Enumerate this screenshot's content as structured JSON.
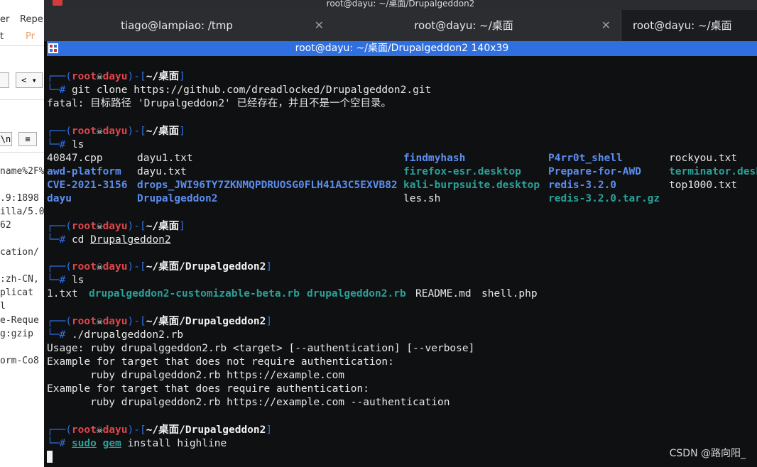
{
  "bg_app": {
    "menu": [
      "er",
      "Repe"
    ],
    "submenu": [
      "t",
      "Pr"
    ],
    "nav_back": "<",
    "nav_more": "▾",
    "toolbar_fmt": "\\n",
    "toolbar_menu": "≡",
    "lines": [
      "name%2F%",
      ".9:1898",
      "illa/5.0",
      " 62",
      "cation/",
      ":zh-CN,",
      "plicat",
      "l",
      "e-Reque",
      "g:gzip",
      "orm-Co8"
    ]
  },
  "window": {
    "title": "root@dayu: ~/桌面/Drupalgeddon2",
    "tabs": [
      {
        "label": "tiago@lampiao: /tmp"
      },
      {
        "label": "root@dayu: ~/桌面"
      },
      {
        "label": "root@dayu: ~/桌面"
      }
    ],
    "inner_title": "root@dayu: ~/桌面/Drupalgeddon2 140x39"
  },
  "prompt": {
    "user": "root",
    "skull": "☠",
    "host": "dayu",
    "home": "~/桌面",
    "dir": "~/桌面/Drupalgeddon2"
  },
  "session": {
    "cmd1": "git clone https://github.com/dreadlocked/Drupalgeddon2.git",
    "out1": "fatal: 目标路径 'Drupalgeddon2' 已经存在，并且不是一个空目录。",
    "cmd2": "ls",
    "ls_files": [
      [
        "40847.cpp",
        "dayu1.txt",
        "findmyhash",
        "P4rr0t_shell",
        "rockyou.txt"
      ],
      [
        "awd-platform",
        "dayu.txt",
        "firefox-esr.desktop",
        "Prepare-for-AWD",
        "terminator.desk"
      ],
      [
        "CVE-2021-3156",
        "drops_JWI96TY7ZKNMQPDRUOSG0FLH41A3C5EXVB82",
        "kali-burpsuite.desktop",
        "redis-3.2.0",
        "top1000.txt"
      ],
      [
        "dayu",
        "Drupalgeddon2",
        "les.sh",
        "redis-3.2.0.tar.gz",
        ""
      ]
    ],
    "cmd3_pre": "cd ",
    "cmd3_arg": "Drupalgeddon2",
    "cmd4": "ls",
    "ls2": [
      "1.txt",
      "drupalgeddon2-customizable-beta.rb",
      "drupalgeddon2.rb",
      "README.md",
      "shell.php"
    ],
    "cmd5": "./drupalgeddon2.rb",
    "usage": [
      "Usage: ruby drupalggeddon2.rb <target> [--authentication] [--verbose]",
      "Example for target that does not require authentication:",
      "       ruby drupalgeddon2.rb https://example.com",
      "Example for target that does require authentication:",
      "       ruby drupalgeddon2.rb https://example.com --authentication"
    ],
    "cmd6_sudo": "sudo",
    "cmd6_gem": "gem",
    "cmd6_rest": " install highline"
  },
  "watermark": "CSDN @路向阳_"
}
